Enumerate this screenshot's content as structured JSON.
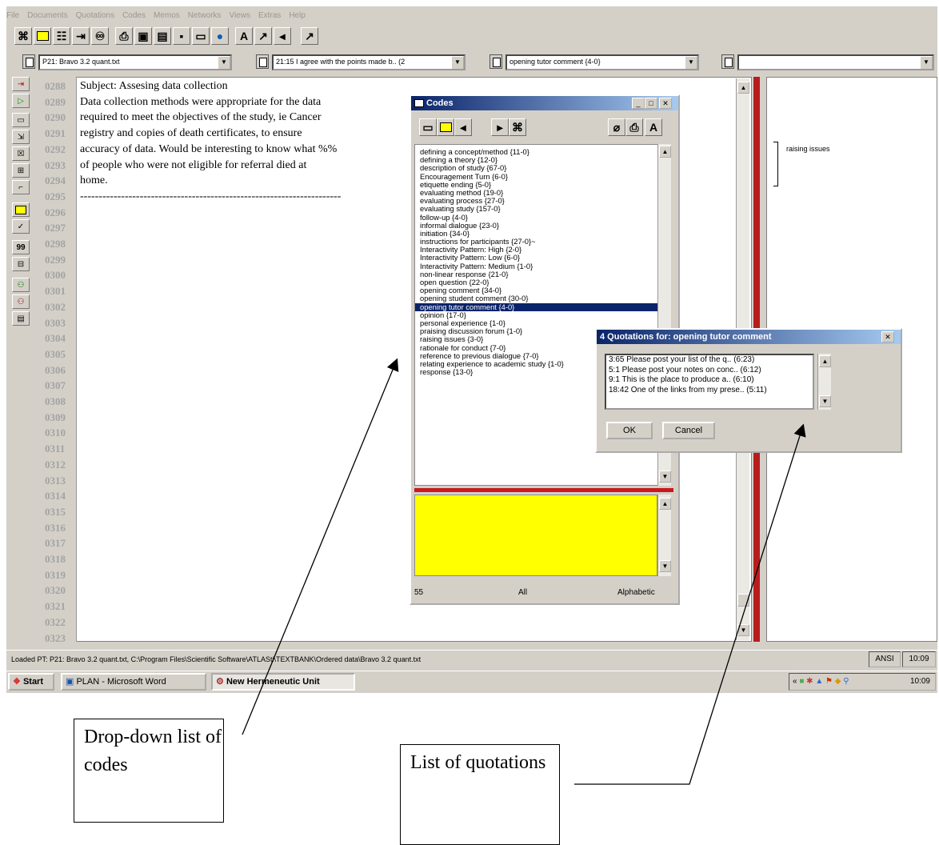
{
  "menu": [
    "File",
    "Documents",
    "Quotations",
    "Codes",
    "Memos",
    "Networks",
    "Views",
    "Extras",
    "Help"
  ],
  "selectors": {
    "document": "P21: Bravo 3.2 quant.txt",
    "quotation": "21:15 I agree with the points made b.. (2",
    "code": "opening tutor comment {4-0}",
    "memo": ""
  },
  "line_numbers": [
    "0288",
    "0289",
    "0290",
    "0291",
    "0292",
    "0293",
    "0294",
    "0295",
    "0296",
    "0297",
    "0298",
    "0299",
    "0300",
    "0301",
    "0302",
    "0303",
    "0304",
    "0305",
    "0306",
    "0307",
    "0308",
    "0309",
    "0310",
    "0311",
    "0312",
    "0313",
    "0314",
    "0315",
    "0316",
    "0317",
    "0318",
    "0319",
    "0320",
    "0321",
    "0322",
    "0323"
  ],
  "document_lines": [
    "Subject: Assesing data collection",
    "Data collection methods were appropriate for the data",
    "required to meet the objectives of the study, ie Cancer",
    "registry and copies of death certificates, to ensure",
    "accuracy of data.  Would be interesting to know what %%",
    "of people who were not eligible for referral died at",
    "home.",
    "----------------------------------------------------------------------"
  ],
  "margin_code": "raising issues",
  "codes_window": {
    "title": "Codes",
    "codes": [
      "defining a concept/method {11-0}",
      "defining a theory {12-0}",
      "description of study {67-0}",
      "Encouragement Turn {6-0}",
      "etiquette ending {5-0}",
      "evaluating method {19-0}",
      "evaluating process {27-0}",
      "evaluating study {157-0}",
      "follow-up {4-0}",
      "informal dialogue {23-0}",
      "initiation {34-0}",
      "instructions for participants {27-0}~",
      "Interactivity Pattern: High {2-0}",
      "Interactivity Pattern: Low {6-0}",
      "Interactivity Pattern: Medium {1-0}",
      "non-linear response {21-0}",
      "open question {22-0}",
      "opening comment {34-0}",
      "opening student comment {30-0}",
      "opening tutor comment {4-0}",
      "opinion {17-0}",
      "personal experience {1-0}",
      "praising discussion forum {1-0}",
      "raising issues {3-0}",
      "rationale for conduct {7-0}",
      "reference to previous dialogue {7-0}",
      "relating experience to academic study {1-0}",
      "response {13-0}"
    ],
    "selected_index": 19,
    "status": {
      "count": "55",
      "filter": "All",
      "sort": "Alphabetic"
    }
  },
  "quotations_dialog": {
    "title": "4 Quotations for: opening tutor comment",
    "items": [
      "3:65 Please post your list of the q.. (6:23)",
      "5:1 Please post your notes on conc.. (6:12)",
      "9:1 This is the place to produce a.. (6:10)",
      "18:42 One of the links from my prese.. (5:11)"
    ],
    "ok": "OK",
    "cancel": "Cancel"
  },
  "status_bar": {
    "text": "Loaded PT: P21: Bravo 3.2 quant.txt, C:\\Program Files\\Scientific Software\\ATLASti\\TEXTBANK\\Ordered data\\Bravo 3.2 quant.txt",
    "encoding": "ANSI",
    "time": "10:09"
  },
  "taskbar": {
    "start": "Start",
    "tasks": [
      "PLAN - Microsoft Word",
      "New Hermeneutic Unit"
    ],
    "clock": "10:09"
  },
  "callouts": {
    "codes": "Drop-down list of codes",
    "quotations": "List of quotations"
  }
}
